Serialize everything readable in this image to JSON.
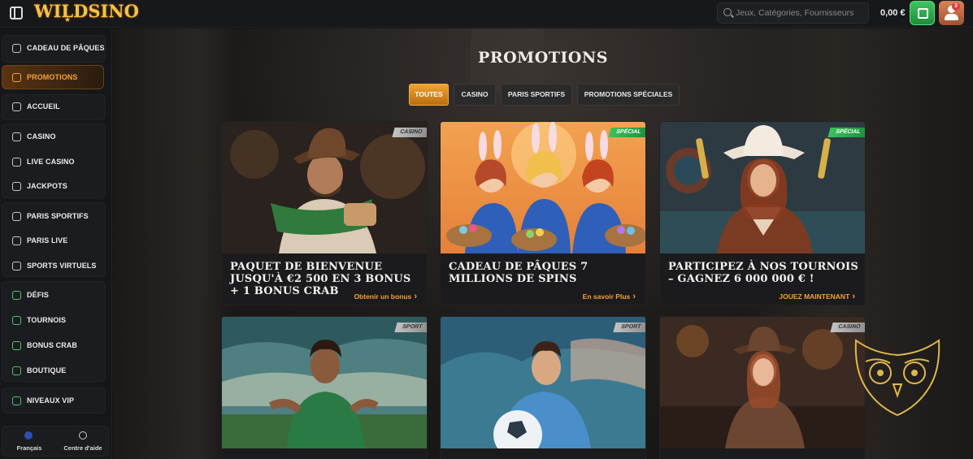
{
  "app": {
    "logo": "WILDSINO",
    "logo_star": "★"
  },
  "header": {
    "search": {
      "placeholder": "Jeux, Catégories, Fournisseurs"
    },
    "balance": "0,00 €",
    "notification_count": "3"
  },
  "sidebar": {
    "items": [
      {
        "label": "CADEAU DE PÂQUES",
        "icon": "gift-icon"
      },
      {
        "label": "PROMOTIONS",
        "icon": "promotion-icon",
        "active": true
      },
      {
        "label": "ACCUEIL",
        "icon": "home-icon"
      },
      {
        "label": "CASINO",
        "icon": "casino-chip-icon"
      },
      {
        "label": "LIVE CASINO",
        "icon": "live-icon"
      },
      {
        "label": "JACKPOTS",
        "icon": "jackpot-icon"
      },
      {
        "label": "PARIS SPORTIFS",
        "icon": "ball-icon"
      },
      {
        "label": "PARIS LIVE",
        "icon": "tv-icon"
      },
      {
        "label": "SPORTS VIRTUELS",
        "icon": "virtual-icon"
      },
      {
        "label": "DÉFIS",
        "icon": "challenge-icon"
      },
      {
        "label": "TOURNOIS",
        "icon": "trophy-icon"
      },
      {
        "label": "BONUS CRAB",
        "icon": "crab-icon"
      },
      {
        "label": "BOUTIQUE",
        "icon": "shop-icon"
      },
      {
        "label": "NIVEAUX VIP",
        "icon": "vip-icon"
      }
    ],
    "language": "Français",
    "help": "Centre d'aide"
  },
  "main": {
    "title": "PROMOTIONS",
    "tabs": [
      {
        "label": "TOUTES",
        "active": true
      },
      {
        "label": "CASINO"
      },
      {
        "label": "PARIS SPORTIFS"
      },
      {
        "label": "PROMOTIONS SPÉCIALES"
      }
    ],
    "cards": [
      {
        "badge": "CASINO",
        "title": "PAQUET DE BIENVENUE JUSQU'À €2 500 EN 3 BONUS + 1 BONUS CRAB",
        "cta": "Obtenir un bonus"
      },
      {
        "badge": "SPÉCIAL",
        "title": "CADEAU DE PÂQUES 7 MILLIONS DE SPINS",
        "cta": "En savoir Plus"
      },
      {
        "badge": "SPÉCIAL",
        "title": "PARTICIPEZ À NOS TOURNOIS – GAGNEZ 6 000 000 € !",
        "cta": "JOUEZ MAINTENANT"
      },
      {
        "badge": "SPORT",
        "title": "",
        "cta": ""
      },
      {
        "badge": "SPORT",
        "title": "",
        "cta": ""
      },
      {
        "badge": "CASINO",
        "title": "",
        "cta": ""
      }
    ]
  },
  "colors": {
    "accent": "#f6a13a",
    "special": "#3bc45a",
    "background": "#141518"
  }
}
